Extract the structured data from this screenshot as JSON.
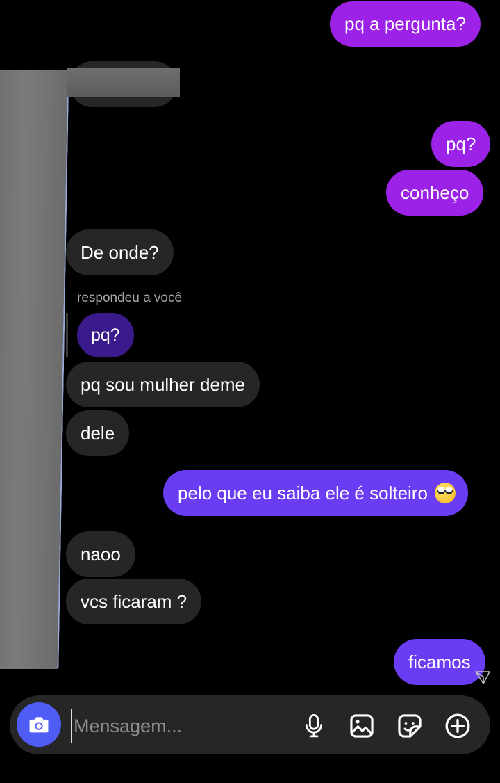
{
  "messages": {
    "m1": "pq a pergunta?",
    "m2": "pq?",
    "m3": "conheço",
    "m4": "De onde?",
    "reply_caption": "respondeu a você",
    "reply_quote": "pq?",
    "m5": "pq sou mulher deme",
    "m6": "dele",
    "m7": "pelo que eu saiba ele é solteiro",
    "m8": "naoo",
    "m9": "vcs ficaram ?",
    "m10": "ficamos"
  },
  "composer": {
    "placeholder": "Mensagem...",
    "icons": [
      "camera-icon",
      "microphone-icon",
      "gallery-icon",
      "sticker-icon",
      "add-icon"
    ]
  },
  "colors": {
    "background": "#000000",
    "outgoing_purple": "#9b22e6",
    "outgoing_violet": "#6a3cf3",
    "incoming": "#262626",
    "camera_button": "#4f5cf5"
  }
}
